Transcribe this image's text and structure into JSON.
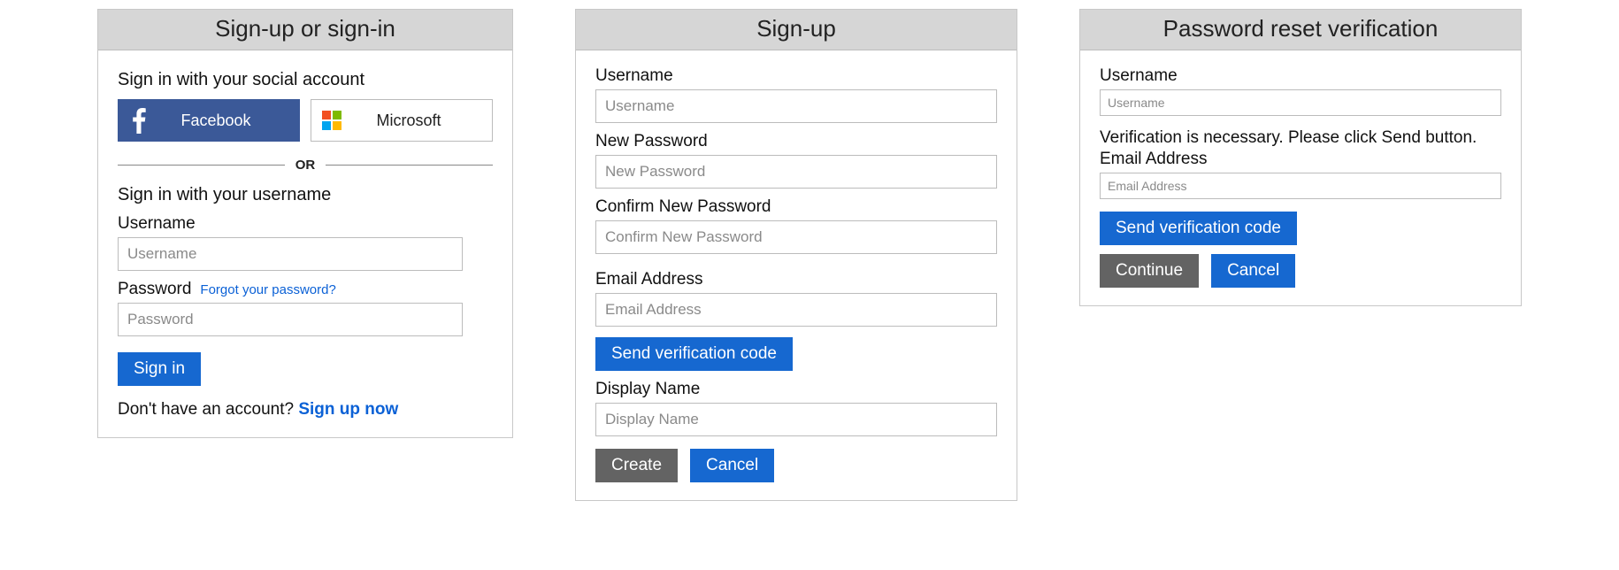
{
  "signin": {
    "header": "Sign-up or sign-in",
    "social_title": "Sign in with your social account",
    "facebook_label": "Facebook",
    "microsoft_label": "Microsoft",
    "divider": "OR",
    "username_title": "Sign in with your username",
    "username_label": "Username",
    "username_placeholder": "Username",
    "password_label": "Password",
    "forgot_label": "Forgot your password?",
    "password_placeholder": "Password",
    "signin_button": "Sign in",
    "signup_prompt": "Don't have an account?",
    "signup_link": "Sign up now"
  },
  "signup": {
    "header": "Sign-up",
    "username_label": "Username",
    "username_placeholder": "Username",
    "new_password_label": "New Password",
    "new_password_placeholder": "New Password",
    "confirm_password_label": "Confirm New Password",
    "confirm_password_placeholder": "Confirm New Password",
    "email_label": "Email Address",
    "email_placeholder": "Email Address",
    "send_code_button": "Send verification code",
    "display_name_label": "Display Name",
    "display_name_placeholder": "Display Name",
    "create_button": "Create",
    "cancel_button": "Cancel"
  },
  "reset": {
    "header": "Password reset verification",
    "username_label": "Username",
    "username_placeholder": "Username",
    "verify_message": "Verification is necessary. Please click Send button.",
    "email_label": "Email Address",
    "email_placeholder": "Email Address",
    "send_code_button": "Send verification code",
    "continue_button": "Continue",
    "cancel_button": "Cancel"
  }
}
